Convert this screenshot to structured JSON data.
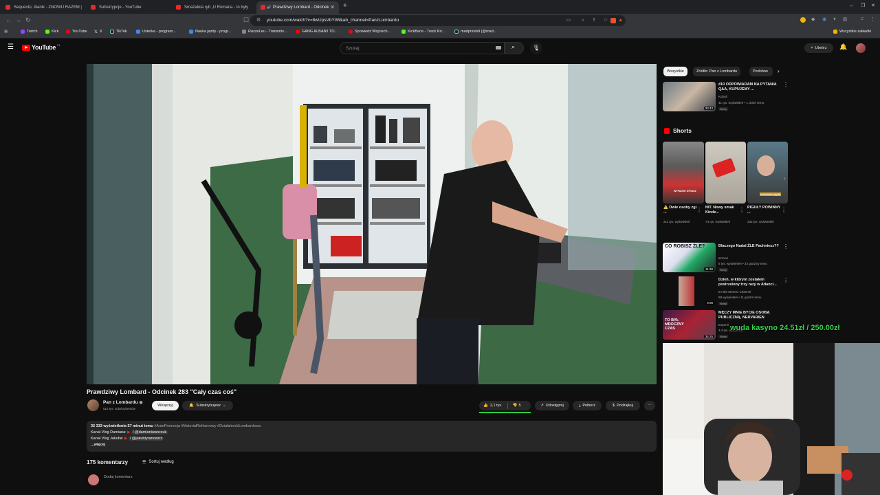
{
  "browser": {
    "tabs": [
      {
        "label": "Sequento, Alanik - ZNOWU RAZEM |"
      },
      {
        "label": "Subskrypcje - YouTube"
      },
      {
        "label": "Smażalnia ryb „U Romana - to były"
      },
      {
        "label": "Prawdziwy Lombard - Odcinek",
        "active": true
      }
    ],
    "url": "youtube.com/watch?v=8wUpsVbYWi&ab_channel=PanzLombardu",
    "bookmarks": [
      "Twitch",
      "Kick",
      "YouTube",
      "X",
      "TikTok",
      "Usterka - program...",
      "Nauka jazdy - progr...",
      "RazzeLeu - Transmis...",
      "GANG ALBANII TO...",
      "Spowiedź Wojciech...",
      "KickBans - Track Kic...",
      "madpricelol (@mad..."
    ],
    "all_bookmarks": "Wszystkie zakładki"
  },
  "youtube": {
    "logo": "YouTube",
    "logo_sup": "PL",
    "search_placeholder": "Szukaj",
    "create_label": "Utwórz"
  },
  "video": {
    "title": "Prawdziwy Lombard - Odcinek 283 \"Cały czas coś\"",
    "channel": "Pan z Lombardu",
    "subscribers": "512 tys. subskrybentów",
    "support_label": "Wesprzyj",
    "subscribed_label": "Subskrybujesz",
    "likes": "2,1 tys.",
    "dislike_count": "5",
    "share_label": "Udostępnij",
    "download_label": "Pobierz",
    "thanks_label": "Podziękuj",
    "views_line": "32 333 wyświetlenia  57 minut temu",
    "hashtags": "#AutoPromocja #MateriałReklamowy #DziałalnośćLombardowa",
    "kanal1_label": "Kanał Vlog Damiana:",
    "kanal1_handle": "/ @damianiwanczuk",
    "kanal2_label": "Kanał Vlog Jakuba:",
    "kanal2_handle": "/ @jakubtyranowicz",
    "more_label": "...więcej",
    "comments_count": "175 komentarzy",
    "sort_label": "Sortuj według",
    "add_comment": "Dodaj komentarz"
  },
  "sidebar": {
    "chips": [
      "Wszystkie",
      "Źródło: Pan z Lombardu",
      "Podobne"
    ],
    "top_video": {
      "title": "#10 ODPOWIADAM NA PYTANIA Q&A, KUPUJEMY ...",
      "channel": "Kubuś",
      "meta": "41 tys. wyświetleń • 1 dzień temu",
      "badge": "Nowy",
      "duration": "30:43"
    },
    "shorts_title": "Shorts",
    "shorts": [
      {
        "title": "⚠️ Dwie osoby zgi ...",
        "views": "211 tys. wyświetleń",
        "overlay": "WYPADEK STRASZ"
      },
      {
        "title": "HIT. Nowy smak Kinde...",
        "views": "74 tys. wyświetleń",
        "overlay": ""
      },
      {
        "title": "PIGUŁY POWINNY ...",
        "views": "333 tys. wyświetleń",
        "overlay": "człowieka pigułę"
      }
    ],
    "videos": [
      {
        "title": "Dlaczego Nadal ŹLE Pachniesz??",
        "channel": "azmeci",
        "meta": "6 tys. wyświetleń • 23 godziny temu",
        "badge": "Nowy",
        "duration": "11:30",
        "thumb_text": "CO ROBISZ ŹLE?"
      },
      {
        "title": "Dzień, w którym zostałem postrzelony trzy razy w Atlanci...",
        "channel": "It's the Moreez Channel",
        "meta": "88 wyświetleń • 11 godzin temu",
        "badge": "Nowy",
        "duration": "9:06",
        "thumb_text": ""
      },
      {
        "title": "MĘCZY MNIE BYCIE OSOBĄ PUBLICZNĄ, NERVARIEN",
        "channel": "Expomi",
        "meta": "4,3 tys. wyświetleń",
        "badge": "Nowy",
        "duration": "35:25",
        "thumb_text": "TO BYŁ MROCZNY CZAS"
      }
    ]
  },
  "stream_overlay": {
    "text": "wuda kasyno 24.51zł / 250.00zł"
  },
  "colors": {
    "yt_red": "#ff0000",
    "bg": "#0f0f0f",
    "chip": "#272727",
    "overlay_green": "#38d04a"
  }
}
